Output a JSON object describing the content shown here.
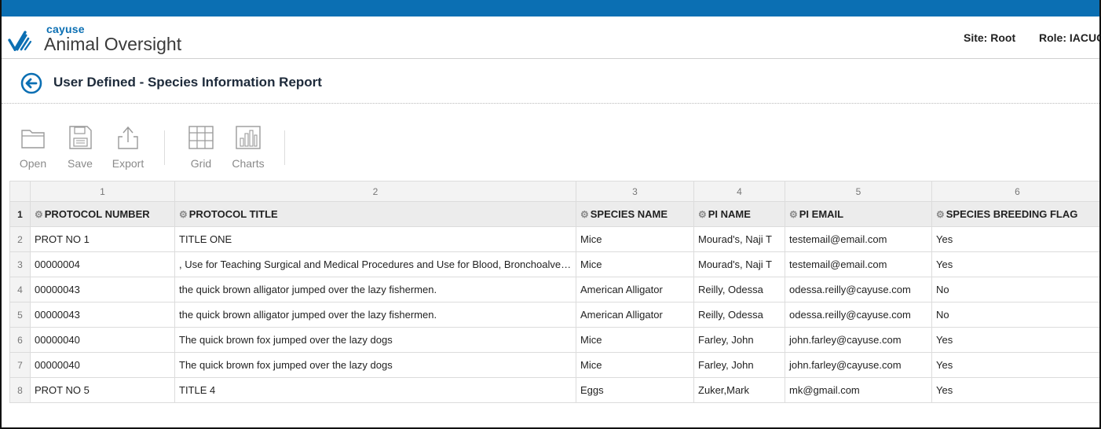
{
  "brand": {
    "small": "cayuse",
    "big": "Animal Oversight"
  },
  "header": {
    "site": "Site: Root",
    "role": "Role: IACUC"
  },
  "page": {
    "title": "User Defined - Species Information Report"
  },
  "toolbar": {
    "open": "Open",
    "save": "Save",
    "export": "Export",
    "grid": "Grid",
    "charts": "Charts"
  },
  "grid": {
    "col_numbers": [
      "1",
      "2",
      "3",
      "4",
      "5",
      "6"
    ],
    "headers": [
      "PROTOCOL NUMBER",
      "PROTOCOL TITLE",
      "SPECIES NAME",
      "PI NAME",
      "PI EMAIL",
      "SPECIES BREEDING FLAG"
    ],
    "row_numbers": [
      "1",
      "2",
      "3",
      "4",
      "5",
      "6",
      "7",
      "8"
    ],
    "rows": [
      [
        "PROT NO 1",
        "TITLE ONE",
        "Mice",
        "Mourad's, Naji T",
        "testemail@email.com",
        "Yes"
      ],
      [
        "00000004",
        ", Use for Teaching Surgical and Medical Procedures and Use for Blood, Bronchoalveolar Lavage",
        "Mice",
        "Mourad's, Naji T",
        "testemail@email.com",
        "Yes"
      ],
      [
        "00000043",
        "the quick brown alligator jumped over the lazy fishermen.",
        "American Alligator",
        "Reilly, Odessa",
        "odessa.reilly@cayuse.com",
        "No"
      ],
      [
        "00000043",
        "the quick brown alligator jumped over the lazy fishermen.",
        "American Alligator",
        "Reilly, Odessa",
        "odessa.reilly@cayuse.com",
        "No"
      ],
      [
        "00000040",
        "The quick brown fox jumped over the lazy dogs",
        "Mice",
        "Farley, John",
        "john.farley@cayuse.com",
        "Yes"
      ],
      [
        "00000040",
        "The quick brown fox jumped over the lazy dogs",
        "Mice",
        "Farley, John",
        "john.farley@cayuse.com",
        "Yes"
      ],
      [
        "PROT NO 5",
        "TITLE 4",
        "Eggs",
        "Zuker,Mark",
        "mk@gmail.com",
        "Yes"
      ]
    ]
  },
  "colors": {
    "topbar": "#0b6fb3",
    "accent": "#0b6fb3"
  },
  "icons": {
    "back": "back-arrow-circle-icon",
    "column_menu": "gear-icon"
  }
}
